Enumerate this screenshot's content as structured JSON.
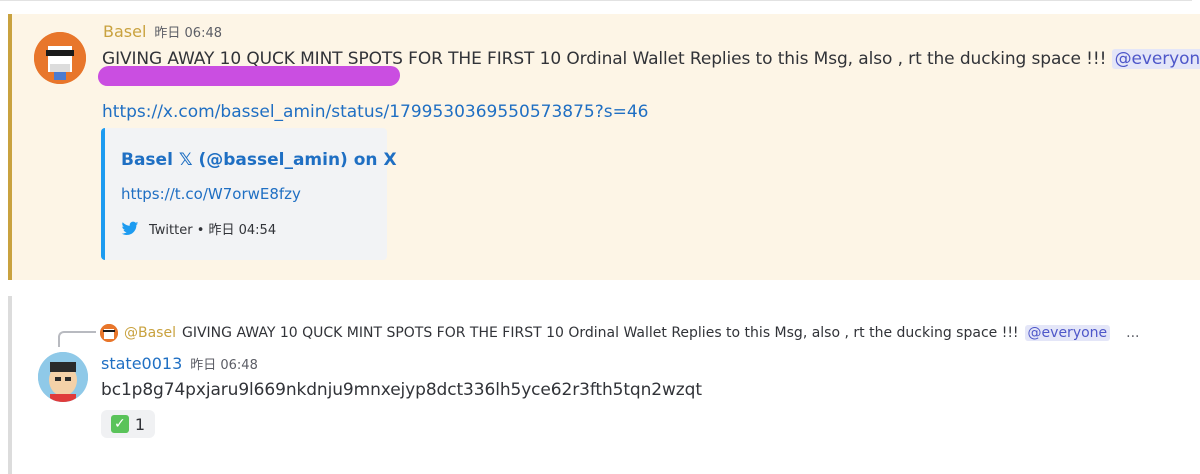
{
  "message1": {
    "author": "Basel",
    "timestamp": "昨日 06:48",
    "content": "GIVING AWAY 10 QUCK MINT SPOTS FOR THE FIRST 10 Ordinal Wallet Replies to this Msg, also , rt the ducking space !!!",
    "mention": "@everyone",
    "link": "https://x.com/bassel_amin/status/1799530369550573875?s=46",
    "embed": {
      "title": "Basel 𝕏 (@bassel_amin) on X",
      "url": "https://t.co/W7orwE8fzy",
      "footer": "Twitter • 昨日 04:54"
    }
  },
  "message2": {
    "reply": {
      "author": "@Basel",
      "content": "GIVING AWAY 10 QUCK MINT SPOTS FOR THE FIRST 10 Ordinal Wallet Replies to this Msg, also , rt the ducking space !!!",
      "mention": "@everyone",
      "more": "..."
    },
    "author": "state0013",
    "timestamp": "昨日 06:48",
    "content": "bc1p8g74pxjaru9l669nkdnju9mnxejyp8dct336lh5yce62r3fth5tqn2wzqt",
    "reaction": {
      "emoji": "white-check-mark",
      "count": "1"
    }
  },
  "colors": {
    "highlight_bg": "#fdf5e6",
    "accent_bar": "#c9a23f",
    "link": "#1f6fc3",
    "mention_bg": "#e4e6f8",
    "mention_text": "#4e57c9",
    "marker": "#c43ce0"
  }
}
